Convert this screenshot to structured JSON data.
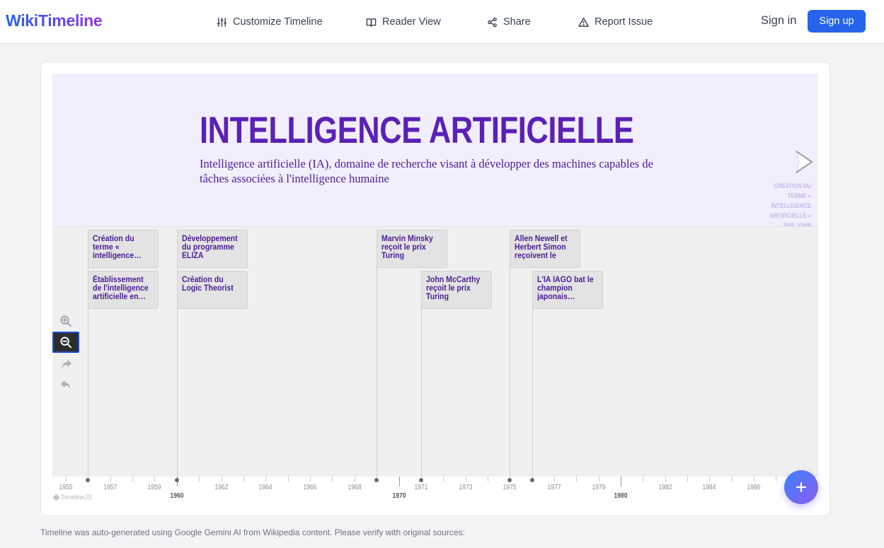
{
  "header": {
    "logo": "WikiTimeline",
    "nav": [
      {
        "label": "Customize Timeline",
        "icon": "sliders-icon"
      },
      {
        "label": "Reader View",
        "icon": "book-open-icon"
      },
      {
        "label": "Share",
        "icon": "share-icon"
      },
      {
        "label": "Report Issue",
        "icon": "alert-triangle-icon"
      }
    ],
    "signin": "Sign in",
    "signup": "Sign up"
  },
  "slide": {
    "title": "INTELLIGENCE ARTIFICIELLE",
    "description": "Intelligence artificielle (IA), domaine de recherche visant à développer des machines capables de tâches associées à l'intelligence humaine",
    "next_label": "CRÉATION DU TERME « INTELLIGENCE ARTIFICIELLE » PAR JOHN MCCARTHY"
  },
  "events": [
    {
      "text": "Création du terme « intelligence…"
    },
    {
      "text": "Établissement de l'intelligence artificielle en…"
    },
    {
      "text": "Développement du programme ELIZA"
    },
    {
      "text": "Création du Logic Theorist"
    },
    {
      "text": "Marvin Minsky reçoit le prix Turing"
    },
    {
      "text": "John McCarthy reçoit le prix Turing"
    },
    {
      "text": "Allen Newell et Herbert Simon reçoivent le pri…"
    },
    {
      "text": "L'IA IAGO bat le champion japonais…"
    }
  ],
  "zoom_controls": [
    {
      "icon": "zoom-in-icon"
    },
    {
      "icon": "zoom-out-icon",
      "active": true
    },
    {
      "icon": "redo-icon"
    },
    {
      "icon": "undo-icon"
    }
  ],
  "axis": {
    "minor_labels": [
      "1955",
      "1957",
      "1959",
      "1962",
      "1964",
      "1966",
      "1968",
      "1971",
      "1973",
      "1975",
      "1977",
      "1979",
      "1982",
      "1984",
      "1986"
    ],
    "major_labels": [
      "1960",
      "1970",
      "1980"
    ]
  },
  "attribution": "TimelineJS",
  "footer": "Timeline was auto-generated using Google Gemini AI from Wikipedia content. Please verify with original sources:",
  "colors": {
    "accent": "#2563eb",
    "title": "#5b21b6",
    "slide_bg": "#f1eefe"
  }
}
